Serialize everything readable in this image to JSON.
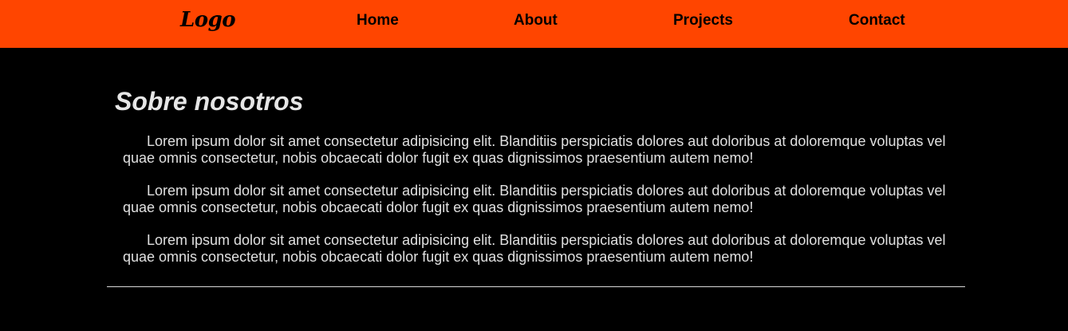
{
  "navbar": {
    "logo": "Logo",
    "links": [
      {
        "label": "Home"
      },
      {
        "label": "About"
      },
      {
        "label": "Projects"
      },
      {
        "label": "Contact"
      }
    ],
    "background_color": "#ff4500"
  },
  "about": {
    "title": "Sobre nosotros",
    "paragraphs": [
      "Lorem ipsum dolor sit amet consectetur adipisicing elit. Blanditiis perspiciatis dolores aut doloribus at doloremque voluptas vel quae omnis consectetur, nobis obcaecati dolor fugit ex quas dignissimos praesentium autem nemo!",
      "Lorem ipsum dolor sit amet consectetur adipisicing elit. Blanditiis perspiciatis dolores aut doloribus at doloremque voluptas vel quae omnis consectetur, nobis obcaecati dolor fugit ex quas dignissimos praesentium autem nemo!",
      "Lorem ipsum dolor sit amet consectetur adipisicing elit. Blanditiis perspiciatis dolores aut doloribus at doloremque voluptas vel quae omnis consectetur, nobis obcaecati dolor fugit ex quas dignissimos praesentium autem nemo!"
    ]
  },
  "colors": {
    "accent": "#ff4500",
    "page_background": "#000000",
    "text": "#e0e0e0"
  }
}
